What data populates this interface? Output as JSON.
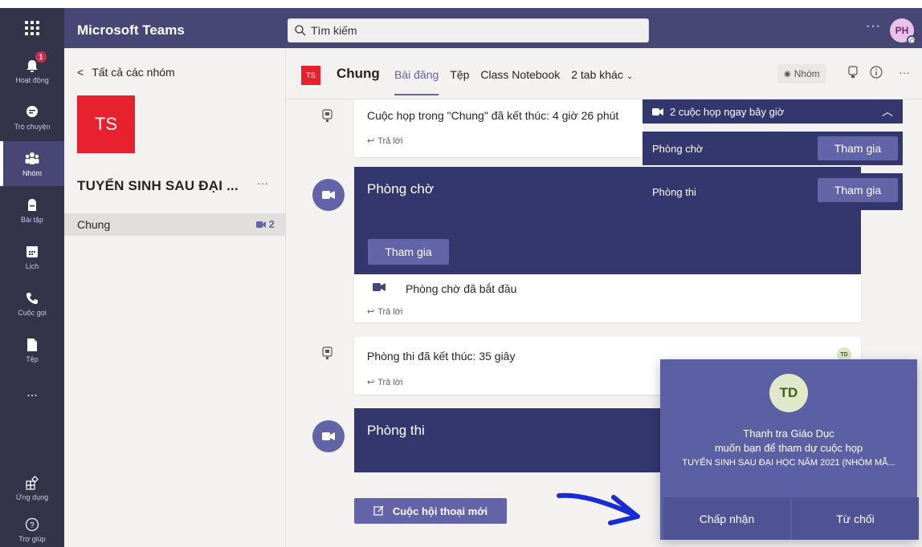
{
  "app": {
    "title": "Microsoft Teams"
  },
  "search": {
    "placeholder": "Tìm kiếm"
  },
  "user": {
    "initials": "PH"
  },
  "rail": {
    "items": [
      {
        "label": "Hoạt động",
        "badge": "1"
      },
      {
        "label": "Trò chuyện"
      },
      {
        "label": "Nhóm"
      },
      {
        "label": "Bài tập"
      },
      {
        "label": "Lịch"
      },
      {
        "label": "Cuộc gọi"
      },
      {
        "label": "Tệp"
      },
      {
        "label": "..."
      },
      {
        "label": "Ứng dụng"
      },
      {
        "label": "Trợ giúp"
      }
    ]
  },
  "panel": {
    "back_label": "Tất cả các nhóm",
    "team_logo": "TS",
    "team_name": "TUYỂN SINH SAU ĐẠI ...",
    "channel": {
      "name": "Chung",
      "meeting_count": "2"
    }
  },
  "header": {
    "logo": "TS",
    "channel_title": "Chung",
    "tabs": [
      "Bài đăng",
      "Tệp",
      "Class Notebook",
      "2 tab khác"
    ],
    "team_button": "Nhóm"
  },
  "feed": {
    "msg1": {
      "text": "Cuộc họp trong \"Chung\" đã kết thúc: 4 giờ 26 phút",
      "reply": "Trả lời"
    },
    "meeting1": {
      "title": "Phòng chờ",
      "join": "Tham gia",
      "started": "Phòng chờ đã bắt đầu",
      "reply": "Trả lời"
    },
    "msg2": {
      "text": "Phòng thi đã kết thúc: 35 giây",
      "reply": "Trả lời",
      "avatar": "TD"
    },
    "meeting2": {
      "title": "Phòng thi"
    },
    "new_conversation": "Cuộc hội thoại mới"
  },
  "meetings_panel": {
    "header": "2 cuộc họp ngay bây giờ",
    "rows": [
      {
        "name": "Phòng chờ",
        "join": "Tham gia"
      },
      {
        "name": "Phòng thi",
        "join": "Tham gia"
      }
    ]
  },
  "invite": {
    "avatar": "TD",
    "line1": "Thanh tra Giáo Dục",
    "line2": "muốn bạn để tham dự cuộc họp",
    "line3": "TUYỂN SINH SAU ĐẠI HỌC NĂM 2021 (NHÓM MẪ...",
    "accept": "Chấp nhận",
    "decline": "Từ chối"
  },
  "colors": {
    "brand": "#6264a7",
    "rail": "#33344a",
    "meeting": "#33376d",
    "team_logo": "#e8212e"
  }
}
